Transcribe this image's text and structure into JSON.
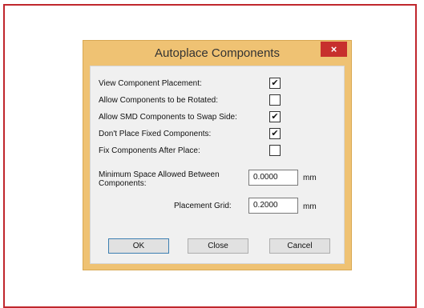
{
  "dialog": {
    "title": "Autoplace Components",
    "close_label": "×"
  },
  "options": [
    {
      "label": "View Component Placement:",
      "checked": true
    },
    {
      "label": "Allow Components to be Rotated:",
      "checked": false
    },
    {
      "label": "Allow SMD Components to Swap Side:",
      "checked": true
    },
    {
      "label": "Don't Place Fixed Components:",
      "checked": true
    },
    {
      "label": "Fix Components After Place:",
      "checked": false
    }
  ],
  "fields": {
    "min_space": {
      "label": "Minimum Space Allowed Between Components:",
      "value": "0.0000",
      "unit": "mm"
    },
    "grid": {
      "label": "Placement Grid:",
      "value": "0.2000",
      "unit": "mm"
    }
  },
  "buttons": {
    "ok": "OK",
    "close": "Close",
    "cancel": "Cancel"
  },
  "check_glyph": "✔",
  "colors": {
    "frame_border": "#c0272d",
    "dialog_frame": "#efc273",
    "close_button": "#c7302d"
  }
}
